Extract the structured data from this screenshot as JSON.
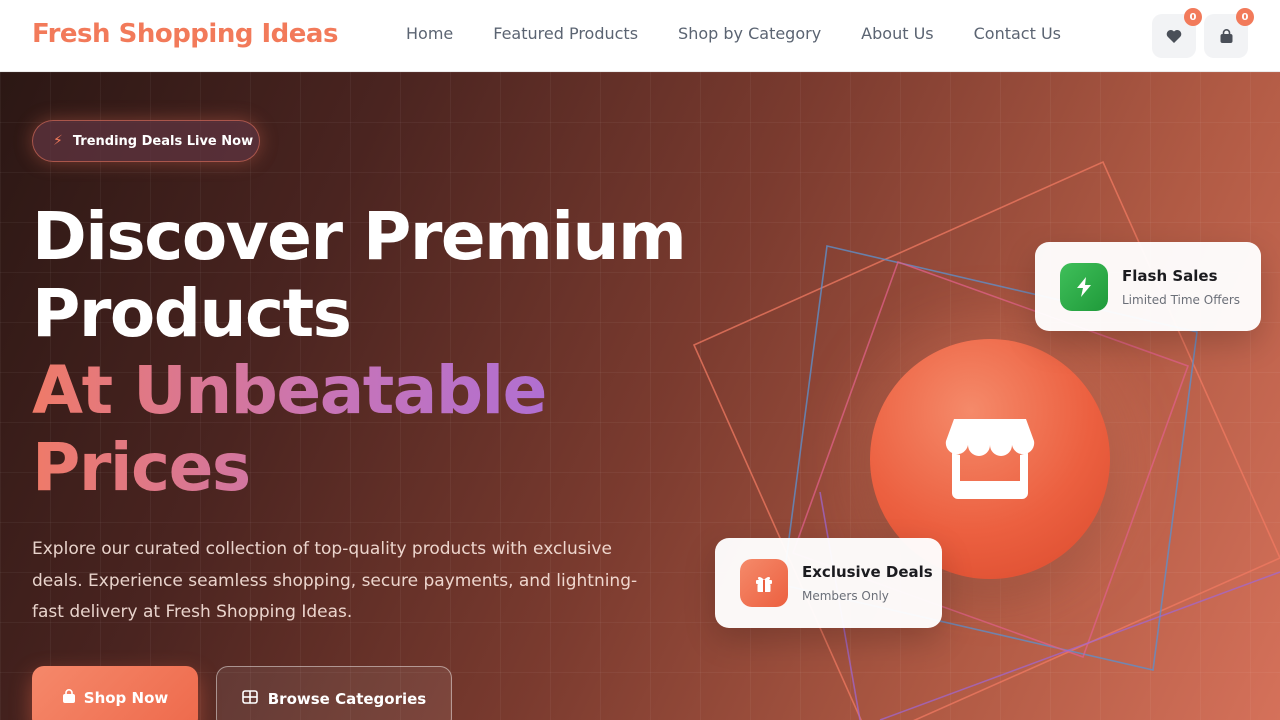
{
  "header": {
    "logo": "Fresh Shopping Ideas",
    "nav": [
      "Home",
      "Featured Products",
      "Shop by Category",
      "About Us",
      "Contact Us"
    ],
    "wishlist_count": "0",
    "cart_count": "0"
  },
  "hero": {
    "badge": "Trending Deals Live Now",
    "title_line1": "Discover Premium",
    "title_line2": "Products",
    "title_line3": "At Unbeatable",
    "title_line4": "Prices",
    "lead": "Explore our curated collection of top-quality products with exclusive deals. Experience seamless shopping, secure payments, and lightning-fast delivery at Fresh Shopping Ideas.",
    "primary_button": "Shop Now",
    "secondary_button": "Browse Categories"
  },
  "cards": {
    "flash": {
      "title": "Flash Sales",
      "subtitle": "Limited Time Offers"
    },
    "exclusive": {
      "title": "Exclusive Deals",
      "subtitle": "Members Only"
    }
  },
  "colors": {
    "accent": "#f27a5a",
    "green": "#2fae4a",
    "text_nav": "#5b6472"
  },
  "icons": [
    "heart-icon",
    "shopping-bag-icon",
    "bolt-icon",
    "store-icon",
    "gift-icon",
    "grid-icon"
  ]
}
